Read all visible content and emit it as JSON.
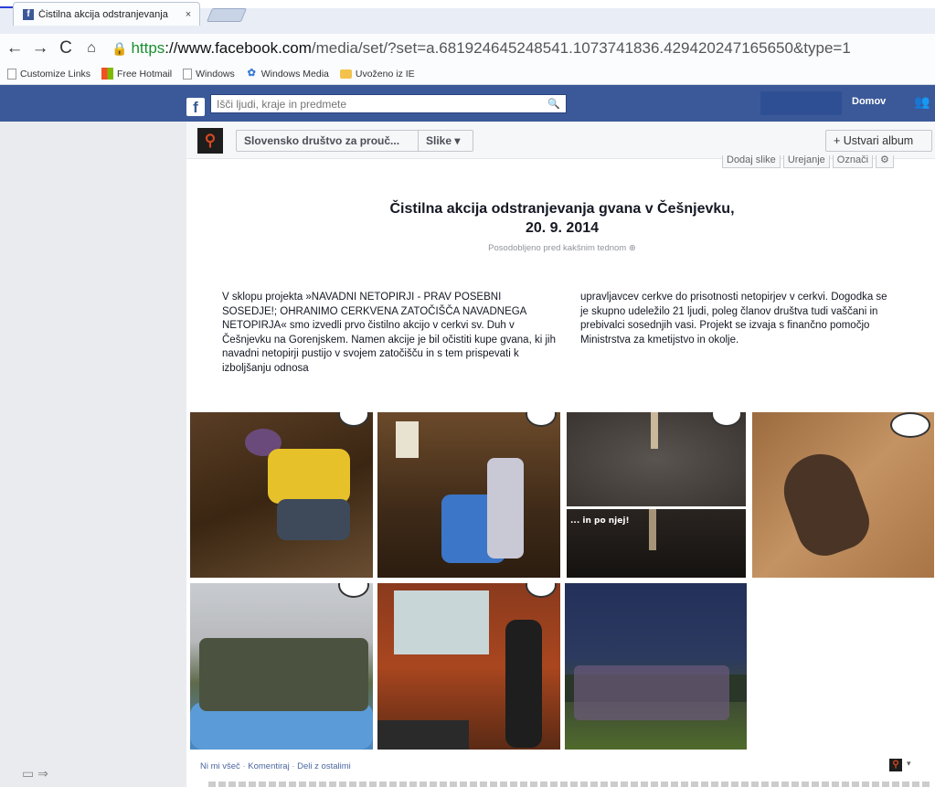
{
  "browser": {
    "tab_title": "Čistilna akcija odstranjevanja",
    "tab_close": "×",
    "url_https": "https",
    "url_host": "://www.facebook.com",
    "url_path": "/media/set/?set=a.681924645248541.1073741836.429420247165650&type=1",
    "nav": {
      "back": "←",
      "forward": "→",
      "reload": "C",
      "home": "⌂"
    },
    "bookmarks": [
      {
        "label": "Customize Links",
        "icon": "page-icon"
      },
      {
        "label": "Free Hotmail",
        "icon": "microsoft-icon"
      },
      {
        "label": "Windows",
        "icon": "page-icon"
      },
      {
        "label": "Windows Media",
        "icon": "windows-media-icon"
      },
      {
        "label": "Uvoženo iz IE",
        "icon": "folder-icon"
      }
    ]
  },
  "fb": {
    "logo": "f",
    "search_placeholder": "Išči ljudi, kraje in predmete",
    "home_label": "Domov",
    "friends_icon": "👥"
  },
  "page_header": {
    "page_name": "Slovensko društvo za prouč...",
    "photos_label": "Slike ▾",
    "create_album": "+ Ustvari album",
    "album_tools": [
      "Dodaj slike",
      "Urejanje",
      "Označi",
      "⚙"
    ]
  },
  "album": {
    "title_line1": "Čistilna akcija odstranjevanja gvana v Češnjevku,",
    "title_line2": "20. 9. 2014",
    "updated": "Posodobljeno pred kakšnim tednom",
    "updated_icon": "globe-icon",
    "desc_left": "V sklopu projekta »NAVADNI NETOPIRJI - PRAV POSEBNI SOSEDJE!; OHRANIMO CERKVENA ZATOČIŠČA NAVADNEGA NETOPIRJA« smo izvedli prvo čistilno akcijo v cerkvi sv. Duh v Češnjevku na Gorenjskem. Namen akcije je bil očistiti kupe gvana, ki jih navadni netopirji pustijo v svojem zatočišču in s tem prispevati k izboljšanju odnosa",
    "desc_right": "upravljavcev cerkve do prisotnosti netopirjev v cerkvi. Dogodka se je skupno udeležilo 21 ljudi, poleg članov društva tudi vaščani in prebivalci sosednjih vasi. Projekt se izvaja s finančno pomočjo Ministrstva za kmetijstvo in okolje.",
    "photo_caption": "... in po njej!"
  },
  "footer": {
    "like": "Ni mi všeč",
    "comment": "Komentiraj",
    "share": "Deli z ostalimi",
    "sep": " · ",
    "caret": "▾"
  },
  "sidebar_bottom": "▭ ⇒"
}
